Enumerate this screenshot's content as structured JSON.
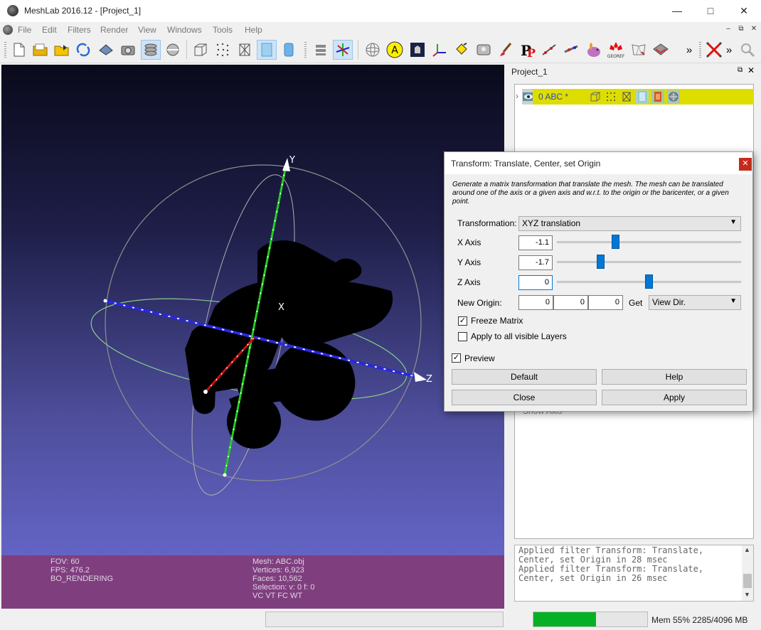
{
  "window": {
    "title": "MeshLab 2016.12 - [Project_1]",
    "icons": {
      "app": "meshlab-logo-icon",
      "minimize": "minimize-icon",
      "maximize": "maximize-icon",
      "close": "close-icon"
    }
  },
  "menu": {
    "items": [
      "File",
      "Edit",
      "Filters",
      "Render",
      "View",
      "Windows",
      "Tools",
      "Help"
    ]
  },
  "toolbar": {
    "icons": [
      "new-project-icon",
      "open-project-icon",
      "import-mesh-icon",
      "reload-icon",
      "save-snapshot-icon",
      "camera-icon",
      "layers-icon",
      "light-icon",
      "bounding-box-icon",
      "points-icon",
      "wireframe-icon",
      "flat-shading-icon",
      "smooth-shading-icon",
      "raster-layers-icon",
      "axis-icon",
      "trackball-icon",
      "text-annotation-icon",
      "texture-icon",
      "xyz-axis-icon",
      "paint-bucket-icon",
      "brush-icon",
      "pp-icon",
      "align-icon",
      "pick-points-icon",
      "rabbit-icon",
      "georef-icon",
      "select-faces-icon",
      "select-vertices-icon",
      "overflow-more-icon",
      "delete-selection-icon",
      "overflow-more-icon-2",
      "search-icon"
    ],
    "georef_label": "GEOREF"
  },
  "viewport": {
    "axis_labels": {
      "x": "X",
      "y": "Y",
      "z": "Z"
    },
    "colors": {
      "x_axis": "#cc1111",
      "y_axis": "#22cc22",
      "z_axis": "#2222dd",
      "mesh": "#000000"
    }
  },
  "info": {
    "fov": "FOV: 60",
    "fps": "FPS:   476.2",
    "rendering": "BO_RENDERING",
    "mesh": "Mesh: ABC.obj",
    "vertices": "Vertices: 6,923",
    "faces": "Faces: 10,562",
    "selection": "Selection: v: 0 f: 0",
    "attributes": "VC VT FC WT"
  },
  "status": {
    "memory_label": "Mem 55% 2285/4096 MB",
    "memory_fraction": 0.55,
    "colors": {
      "progress": "#06b025"
    }
  },
  "layer_panel": {
    "title": "Project_1",
    "layer_label": "0  ABC *",
    "layer_color": "#dddd00",
    "underlying_text": "Show Axis"
  },
  "log": {
    "lines": [
      "Applied filter Transform: Translate,",
      "Center, set Origin in 28 msec",
      "Applied filter Transform: Translate,",
      "Center, set Origin in 26 msec"
    ]
  },
  "dialog": {
    "title": "Transform: Translate, Center, set Origin",
    "description": "Generate a matrix transformation that translate the mesh. The mesh can be translated around one of the axis or a given axis and w.r.t. to the origin or the baricenter, or a given point.",
    "transformation_label": "Transformation:",
    "transformation_value": "XYZ translation",
    "x_axis_label": "X Axis",
    "x_axis_value": "-1.1",
    "x_axis_slider": 0.32,
    "y_axis_label": "Y Axis",
    "y_axis_value": "-1.7",
    "y_axis_slider": 0.24,
    "z_axis_label": "Z Axis",
    "z_axis_value": "0",
    "z_axis_slider": 0.5,
    "new_origin_label": "New Origin:",
    "origin_x": "0",
    "origin_y": "0",
    "origin_z": "0",
    "get_label": "Get",
    "get_value": "View Dir.",
    "freeze_matrix_label": "Freeze Matrix",
    "freeze_matrix_checked": true,
    "apply_all_label": "Apply to all visible Layers",
    "apply_all_checked": false,
    "preview_label": "Preview",
    "preview_checked": true,
    "default_button": "Default",
    "help_button": "Help",
    "close_button": "Close",
    "apply_button": "Apply"
  }
}
